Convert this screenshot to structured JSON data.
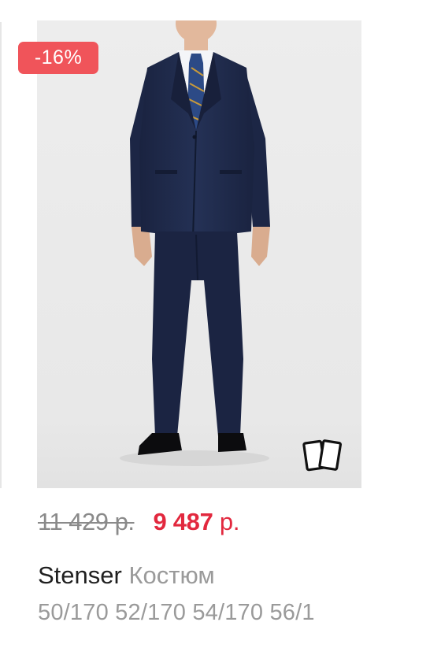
{
  "product": {
    "discount_badge": "-16%",
    "old_price": "11 429 р.",
    "new_price_amount": "9 487",
    "new_price_currency": "р.",
    "brand": "Stenser",
    "type": "Костюм",
    "sizes": "50/170 52/170 54/170 56/1"
  },
  "icons": {
    "gallery": "photo-gallery-icon"
  },
  "colors": {
    "badge_background": "#f0545a",
    "new_price": "#e2283e",
    "old_price": "#8a8a8a",
    "brand_text": "#1f1f1f",
    "secondary_text": "#9a9a9a",
    "photo_background": "#ececec"
  }
}
